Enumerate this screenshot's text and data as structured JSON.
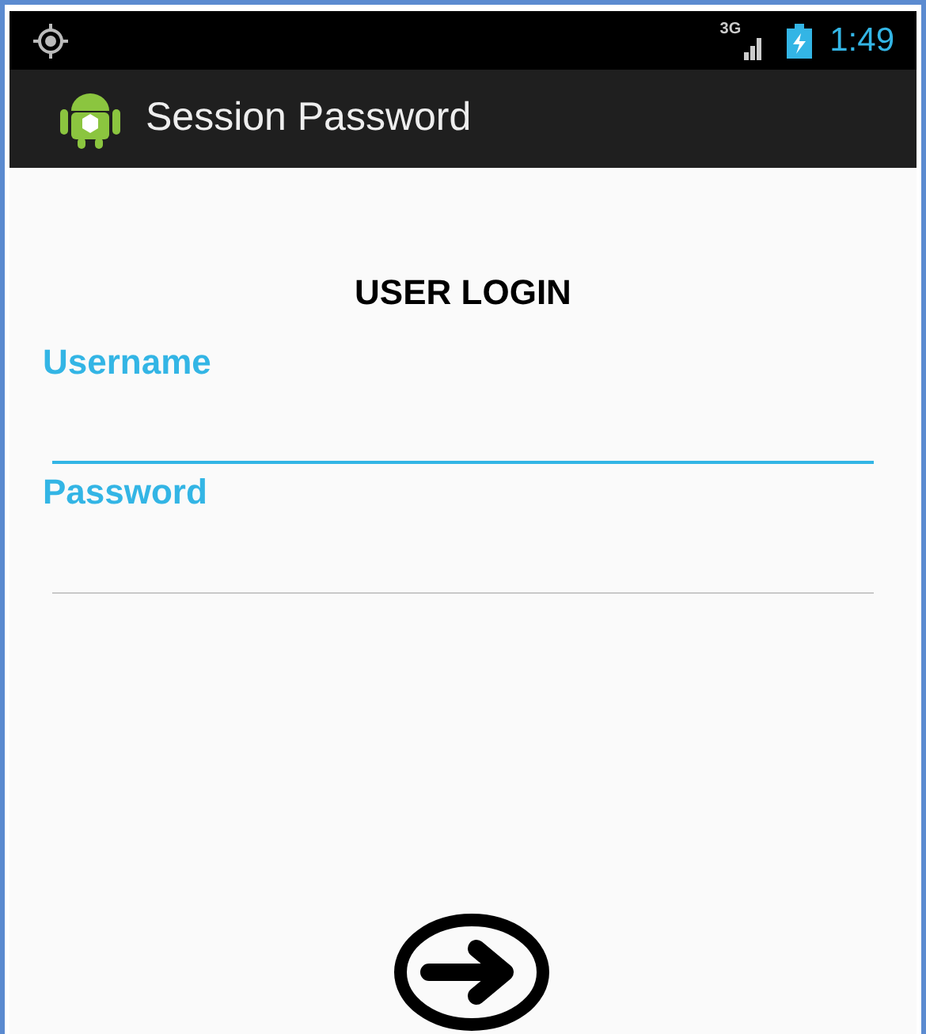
{
  "status_bar": {
    "network": "3G",
    "time": "1:49"
  },
  "action_bar": {
    "title": "Session Password"
  },
  "form": {
    "heading": "USER LOGIN",
    "fields": [
      {
        "label": "Username",
        "focused": true
      },
      {
        "label": "Password",
        "focused": false
      }
    ]
  }
}
